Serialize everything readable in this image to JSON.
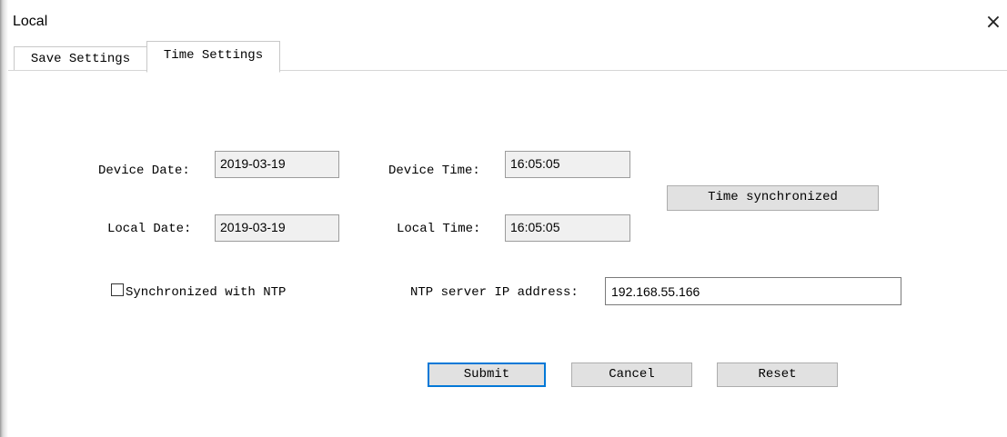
{
  "window": {
    "title": "Local",
    "close_glyph": "×"
  },
  "tabs": [
    {
      "label": "Save Settings",
      "active": false
    },
    {
      "label": "Time Settings",
      "active": true
    }
  ],
  "form": {
    "device_date_label": "Device Date:",
    "device_date_value": "2019-03-19",
    "device_time_label": "Device Time:",
    "device_time_value": "16:05:05",
    "local_date_label": "Local Date:",
    "local_date_value": "2019-03-19",
    "local_time_label": "Local Time:",
    "local_time_value": "16:05:05",
    "sync_button_label": "Time synchronized",
    "ntp_checkbox_label": "Synchronized with NTP",
    "ntp_checked": false,
    "ntp_ip_label": "NTP server IP address:",
    "ntp_ip_value": "192.168.55.166"
  },
  "buttons": {
    "submit": "Submit",
    "cancel": "Cancel",
    "reset": "Reset"
  },
  "colors": {
    "focus_border": "#0078d7",
    "readonly_bg": "#f0f0f0",
    "button_bg": "#e1e1e1"
  }
}
